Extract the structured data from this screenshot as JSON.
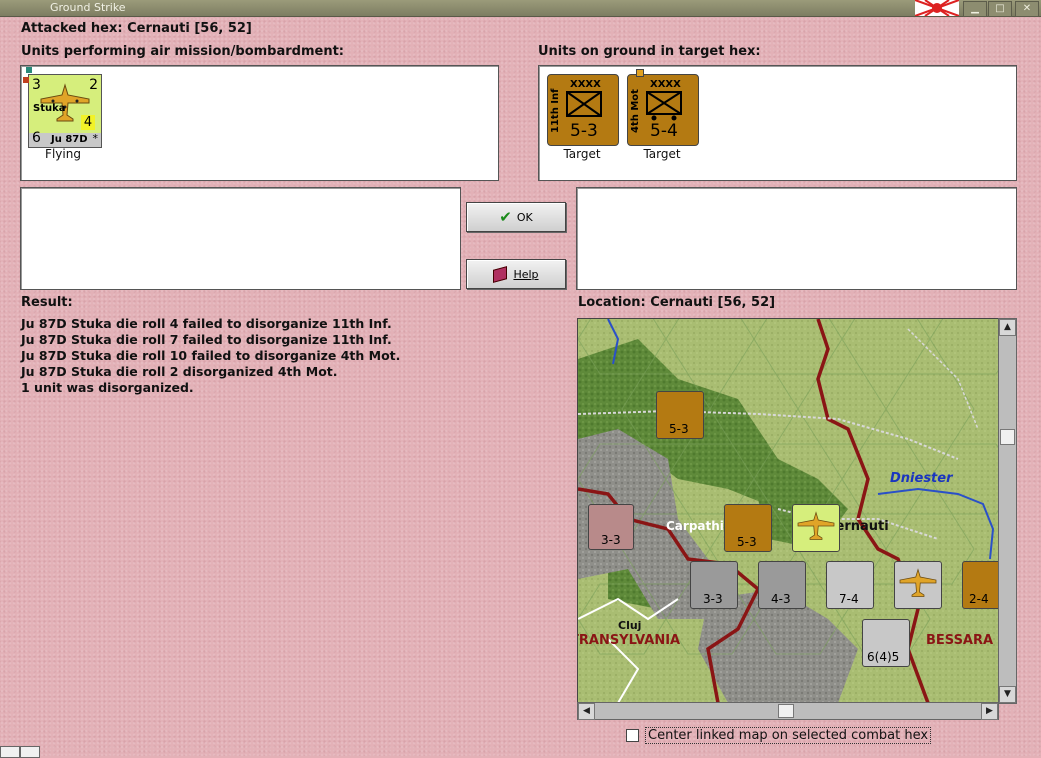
{
  "window": {
    "title": "Ground Strike"
  },
  "header": {
    "attacked_hex": "Attacked hex: Cernauti  [56, 52]"
  },
  "air_panel": {
    "label": "Units performing air mission/bombardment:",
    "units": [
      {
        "name": "Stuka",
        "type": "Ju 87D",
        "top_left": "3",
        "top_right": "2",
        "bottom_left": "6",
        "mid": "4",
        "star": "*",
        "status": "Flying",
        "color": "#d6ee7c"
      }
    ]
  },
  "ground_panel": {
    "label": "Units on ground in target hex:",
    "units": [
      {
        "name": "11th Inf",
        "size": "XXXX",
        "strength": "5-3",
        "status": "Target",
        "color": "#b47a12"
      },
      {
        "name": "4th Mot",
        "size": "XXXX",
        "strength": "5-4",
        "status": "Target",
        "color": "#b47a12"
      }
    ]
  },
  "buttons": {
    "ok": "OK",
    "help": "Help"
  },
  "result": {
    "label": "Result:",
    "lines": [
      "Ju 87D Stuka die roll 4 failed to disorganize 11th Inf.",
      "Ju 87D Stuka die roll 7 failed to disorganize 11th Inf.",
      "Ju 87D Stuka die roll 10 failed to disorganize 4th Mot.",
      "Ju 87D Stuka die roll 2 disorganized 4th Mot.",
      "1 unit was disorganized."
    ]
  },
  "location": {
    "label": "Location:  Cernauti  [56, 52]",
    "map_labels": {
      "river": "Dniester",
      "city1": "Carpathia",
      "city2": "Cernauti",
      "region1": "TRANSYLVANIA",
      "region2": "BESSARA",
      "city3": "Cluj"
    },
    "map_counters": [
      {
        "strength": "5-3",
        "color": "#b47a12"
      },
      {
        "strength": "3-3",
        "color": "#b88a8a"
      },
      {
        "strength": "5-3",
        "color": "#b47a12"
      },
      {
        "strength": "3-3",
        "color": "#9a9a9a"
      },
      {
        "strength": "4-3",
        "color": "#9a9a9a"
      },
      {
        "strength": "7-4",
        "color": "#c8c8c8"
      },
      {
        "strength": "2-4",
        "color": "#b47a12"
      },
      {
        "strength": "6(4)5",
        "color": "#c8c8c8"
      }
    ]
  },
  "footer": {
    "center_checkbox": "Center linked map on selected combat hex",
    "checked": false
  }
}
